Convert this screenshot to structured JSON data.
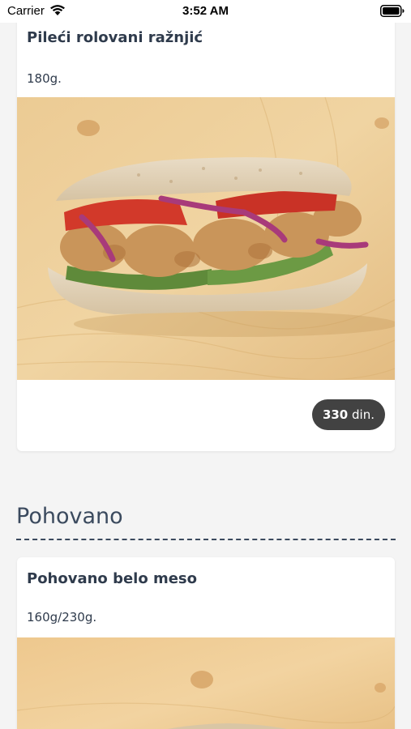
{
  "status_bar": {
    "carrier": "Carrier",
    "time": "3:52 AM"
  },
  "menu": {
    "items": [
      {
        "name": "Pileći rolovani ražnjić",
        "weight": "180g.",
        "price_amount": "330",
        "price_currency": "din."
      },
      {
        "name": "Pohovano belo meso",
        "weight": "160g/230g."
      }
    ],
    "section_title": "Pohovano"
  },
  "colors": {
    "background": "#f4f4f4",
    "card": "#ffffff",
    "text": "#2f3b4c",
    "badge": "#424242"
  }
}
